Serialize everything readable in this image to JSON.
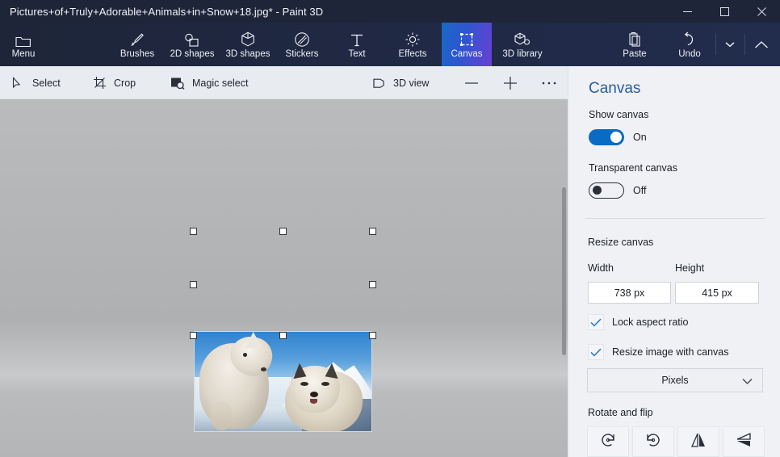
{
  "window": {
    "title": "Pictures+of+Truly+Adorable+Animals+in+Snow+18.jpg*  -  Paint 3D",
    "controls": {
      "minimize": "minimize-icon",
      "maximize": "maximize-icon",
      "close": "close-icon"
    }
  },
  "ribbon": {
    "items": [
      {
        "label": "Menu",
        "icon": "folder-icon",
        "active": false
      },
      {
        "label": "Brushes",
        "icon": "brush-icon",
        "active": false
      },
      {
        "label": "2D shapes",
        "icon": "2d-shapes-icon",
        "active": false
      },
      {
        "label": "3D shapes",
        "icon": "3d-shapes-icon",
        "active": false
      },
      {
        "label": "Stickers",
        "icon": "stickers-icon",
        "active": false
      },
      {
        "label": "Text",
        "icon": "text-icon",
        "active": false
      },
      {
        "label": "Effects",
        "icon": "effects-icon",
        "active": false
      },
      {
        "label": "Canvas",
        "icon": "canvas-icon",
        "active": true
      },
      {
        "label": "3D library",
        "icon": "3d-library-icon",
        "active": false
      },
      {
        "label": "Paste",
        "icon": "clipboard-icon",
        "active": false
      },
      {
        "label": "Undo",
        "icon": "undo-icon",
        "active": false
      }
    ],
    "more_dropdown": "chevron-down-icon",
    "collapse": "chevron-up-icon",
    "active_gradient_start": "#1869c8",
    "active_gradient_end": "#6b3fd4"
  },
  "subtoolbar": {
    "items": [
      {
        "label": "Select",
        "icon": "cursor-arrow-icon"
      },
      {
        "label": "Crop",
        "icon": "crop-icon"
      },
      {
        "label": "Magic select",
        "icon": "magic-select-icon"
      },
      {
        "label": "3D view",
        "icon": "3d-view-icon"
      }
    ],
    "zoom_out": "minus-icon",
    "zoom_in": "plus-icon",
    "overflow": "ellipsis-icon"
  },
  "workspace": {
    "image_alt": "two husky puppies in snow",
    "selection_handles": 8,
    "scrollbar": "vertical-scrollbar"
  },
  "panel": {
    "title": "Canvas",
    "show_canvas": {
      "label": "Show canvas",
      "state": "On",
      "on": true
    },
    "transparent_canvas": {
      "label": "Transparent canvas",
      "state": "Off",
      "on": false
    },
    "resize": {
      "heading": "Resize canvas",
      "width_label": "Width",
      "height_label": "Height",
      "width_value": "738 px",
      "height_value": "415 px",
      "lock_aspect_ratio": {
        "label": "Lock aspect ratio",
        "checked": true
      },
      "resize_image_with_canvas": {
        "label": "Resize image with canvas",
        "checked": true
      },
      "units": "Pixels",
      "units_chevron": "chevron-down-icon"
    },
    "rotate_flip": {
      "heading": "Rotate and flip",
      "buttons": [
        {
          "icon": "rotate-left-icon"
        },
        {
          "icon": "rotate-right-icon"
        },
        {
          "icon": "flip-horizontal-icon"
        },
        {
          "icon": "flip-vertical-icon"
        }
      ]
    },
    "accent_color": "#0a6bc4",
    "heading_color": "#2f5d94"
  }
}
